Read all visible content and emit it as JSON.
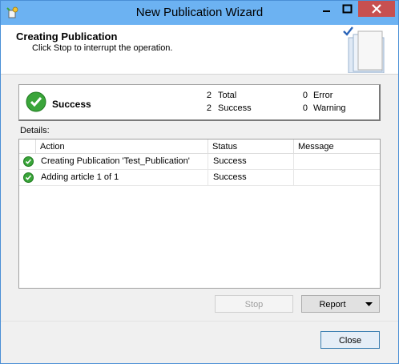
{
  "window": {
    "title": "New Publication Wizard"
  },
  "header": {
    "title": "Creating Publication",
    "subtitle": "Click Stop to interrupt the operation."
  },
  "summary": {
    "status": "Success",
    "total_count": "2",
    "total_label": "Total",
    "success_count": "2",
    "success_label": "Success",
    "error_count": "0",
    "error_label": "Error",
    "warning_count": "0",
    "warning_label": "Warning"
  },
  "details": {
    "label": "Details:",
    "columns": [
      "Action",
      "Status",
      "Message"
    ],
    "rows": [
      {
        "action": "Creating Publication 'Test_Publication'",
        "status": "Success",
        "message": ""
      },
      {
        "action": "Adding article 1 of 1",
        "status": "Success",
        "message": ""
      }
    ]
  },
  "buttons": {
    "stop": "Stop",
    "report": "Report",
    "close": "Close"
  },
  "colors": {
    "titlebar": "#6cb2f2",
    "close_control": "#c75050",
    "success_icon": "#3aa53a"
  }
}
